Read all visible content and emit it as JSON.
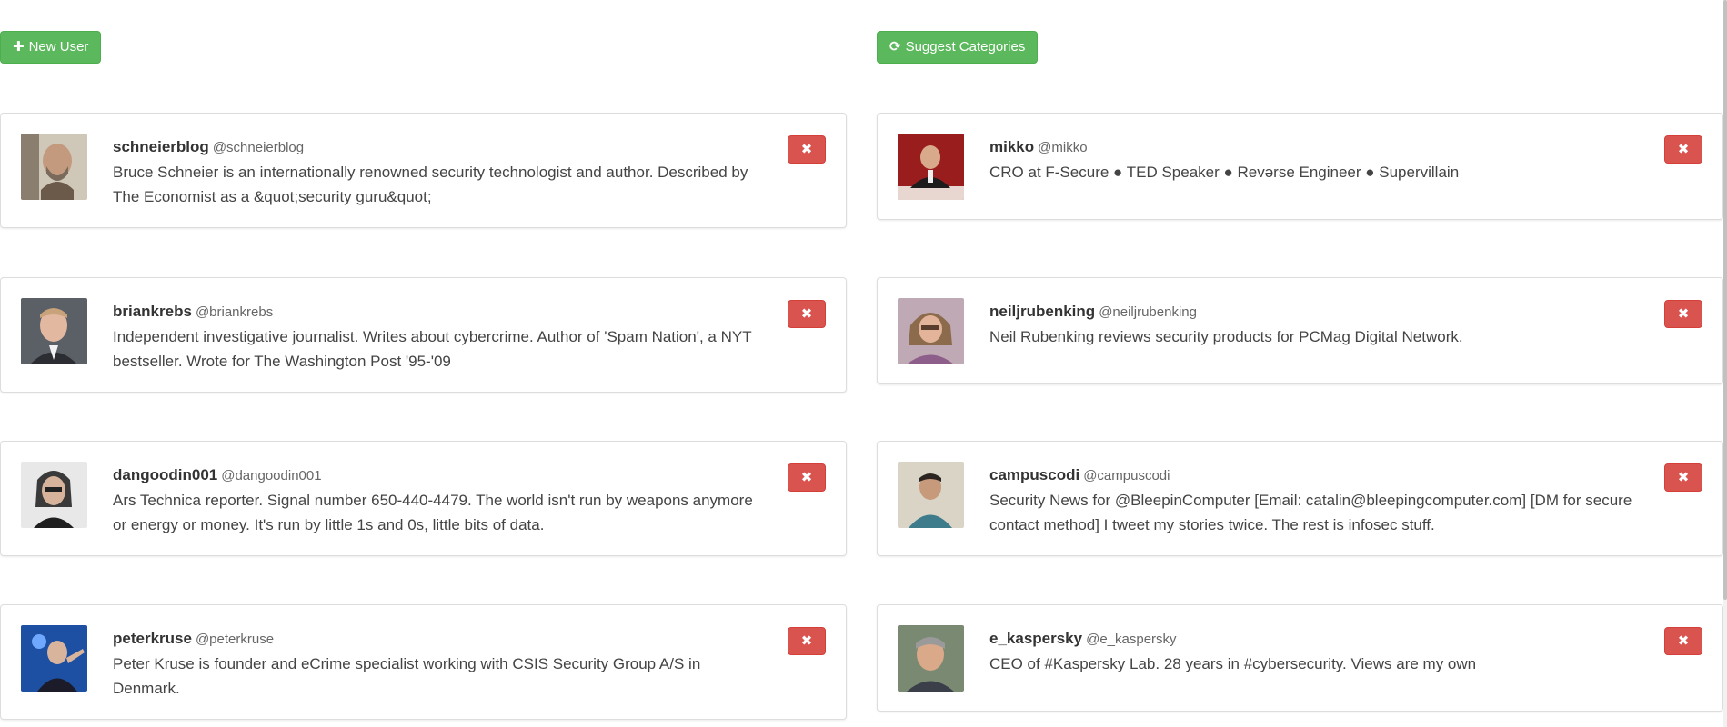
{
  "toolbar": {
    "new_user_label": "New User",
    "new_user_icon": "plus-icon",
    "suggest_label": "Suggest Categories",
    "suggest_icon": "refresh-icon"
  },
  "delete_icon": "times-icon",
  "users_left": [
    {
      "username": "schneierblog",
      "handle": "@schneierblog",
      "bio": "Bruce Schneier is an internationally renowned security technologist and author. Described by The Economist as a &quot;security guru&quot;"
    },
    {
      "username": "briankrebs",
      "handle": "@briankrebs",
      "bio": "Independent investigative journalist. Writes about cybercrime. Author of 'Spam Nation', a NYT bestseller. Wrote for The Washington Post '95-'09"
    },
    {
      "username": "dangoodin001",
      "handle": "@dangoodin001",
      "bio": "Ars Technica reporter. Signal number 650-440-4479. The world isn't run by weapons anymore or energy or money. It's run by little 1s and 0s, little bits of data."
    },
    {
      "username": "peterkruse",
      "handle": "@peterkruse",
      "bio": "Peter Kruse is founder and eCrime specialist working with CSIS Security Group A/S in Denmark."
    }
  ],
  "users_right": [
    {
      "username": "mikko",
      "handle": "@mikko",
      "bio": "CRO at F-Secure ● TED Speaker ● Revərse Engineer ● Supervillain"
    },
    {
      "username": "neiljrubenking",
      "handle": "@neiljrubenking",
      "bio": "Neil Rubenking reviews security products for PCMag Digital Network."
    },
    {
      "username": "campuscodi",
      "handle": "@campuscodi",
      "bio": "Security News for @BleepinComputer [Email: catalin@bleepingcomputer.com] [DM for secure contact method] I tweet my stories twice. The rest is infosec stuff."
    },
    {
      "username": "e_kaspersky",
      "handle": "@e_kaspersky",
      "bio": "CEO of #Kaspersky Lab. 28 years in #cybersecurity. Views are my own"
    }
  ]
}
